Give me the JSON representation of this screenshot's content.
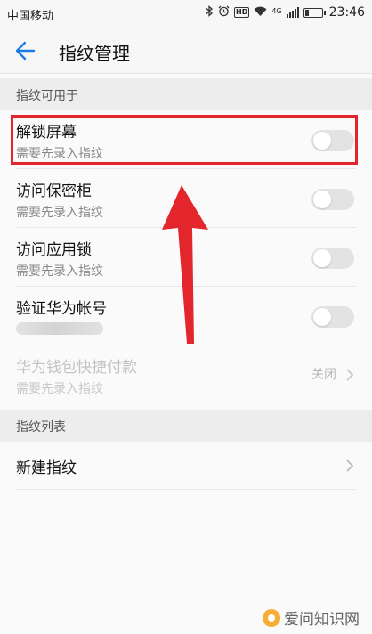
{
  "status_bar": {
    "carrier": "中国移动",
    "time": "23:46",
    "icons": [
      "bluetooth-icon",
      "alarm-icon",
      "hd-icon",
      "wifi-icon",
      "signal-icon",
      "battery-icon"
    ],
    "hd_label": "HD",
    "network_label": "4G",
    "battery_level": 0.25
  },
  "app_bar": {
    "title": "指纹管理",
    "back_icon": "back-arrow-icon",
    "accent": "#1a7ce6"
  },
  "sections": [
    {
      "header": "指纹可用于",
      "rows": [
        {
          "label": "解锁屏幕",
          "sub": "需要先录入指纹",
          "control": "toggle",
          "on": false,
          "enabled": true
        },
        {
          "label": "访问保密柜",
          "sub": "需要先录入指纹",
          "control": "toggle",
          "on": false,
          "enabled": true
        },
        {
          "label": "访问应用锁",
          "sub": "需要先录入指纹",
          "control": "toggle",
          "on": false,
          "enabled": true
        },
        {
          "label": "验证华为帐号",
          "sub": "",
          "control": "toggle",
          "on": false,
          "enabled": true
        },
        {
          "label": "华为钱包快捷付款",
          "sub": "需要先录入指纹",
          "control": "value",
          "value": "关闭",
          "enabled": false
        }
      ]
    },
    {
      "header": "指纹列表",
      "rows": [
        {
          "label": "新建指纹",
          "control": "chevron",
          "enabled": true
        }
      ]
    }
  ],
  "annotation": {
    "color": "#e2262c",
    "target": "解锁屏幕"
  },
  "watermark": {
    "text": "爱问知识网"
  }
}
